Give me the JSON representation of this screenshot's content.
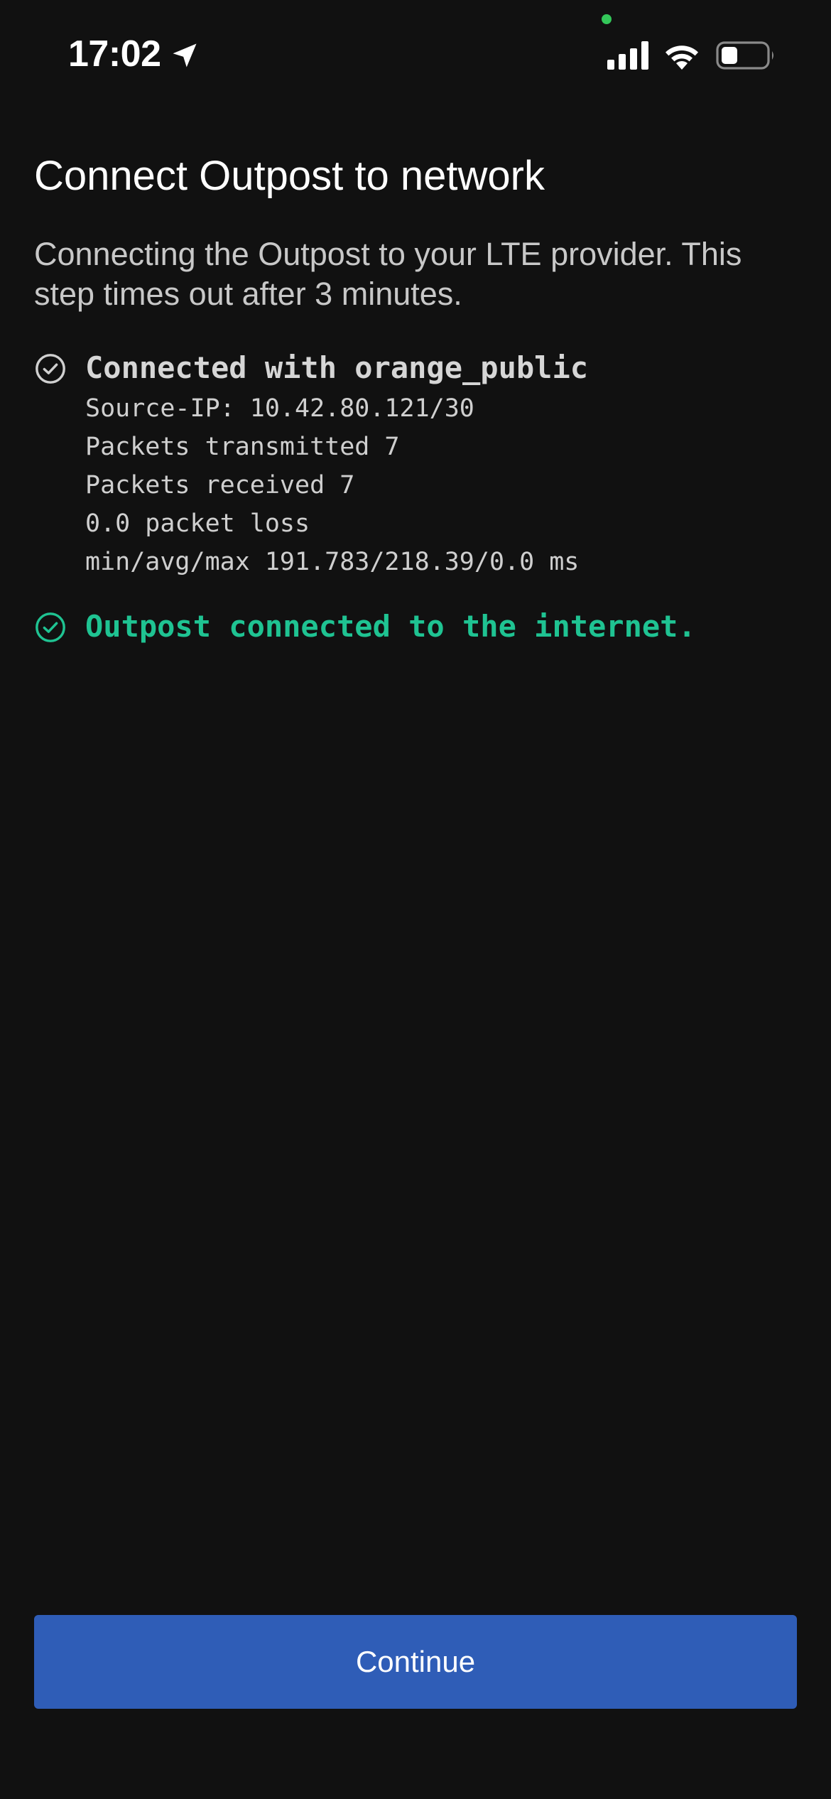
{
  "status_bar": {
    "time": "17:02",
    "icons": [
      "location-arrow-icon",
      "cellular-signal-icon",
      "wifi-icon",
      "battery-icon"
    ],
    "privacy_dot_color": "#33c759"
  },
  "page": {
    "title": "Connect Outpost to network",
    "description": "Connecting the Outpost to your LTE provider. This step times out after 3 minutes."
  },
  "log": {
    "connection": {
      "icon": "check-circle-icon",
      "heading": "Connected with orange_public",
      "lines": [
        "Source-IP: 10.42.80.121/30",
        "Packets transmitted 7",
        "Packets received 7",
        "0.0 packet loss",
        "min/avg/max 191.783/218.39/0.0 ms"
      ]
    },
    "internet": {
      "icon": "check-circle-icon",
      "heading": "Outpost connected to the internet.",
      "color": "#1fc392"
    }
  },
  "footer": {
    "continue_label": "Continue",
    "button_color": "#2f5db7"
  }
}
